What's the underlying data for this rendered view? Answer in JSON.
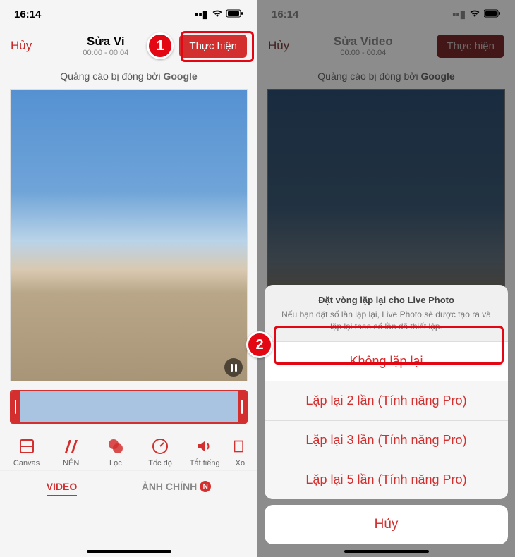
{
  "status": {
    "time": "16:14"
  },
  "header": {
    "cancel": "Hủy",
    "titleFull": "Sửa Video",
    "titleCut": "Sửa Vi",
    "timecode": "00:00 - 00:04",
    "exec": "Thực hiện"
  },
  "ad": {
    "prefix": "Quảng cáo bị đóng bởi ",
    "brand": "Google"
  },
  "tools": {
    "canvas": "Canvas",
    "nen": "NÊN",
    "loc": "Lọc",
    "tocdo": "Tốc độ",
    "tattieng": "Tắt tiếng",
    "xo": "Xo"
  },
  "tabs": {
    "video": "VIDEO",
    "anhchinh": "ẢNH CHÍNH",
    "badge": "N"
  },
  "sheet": {
    "title": "Đặt vòng lặp lại cho Live Photo",
    "desc": "Nếu bạn đặt số lần lặp lại, Live Photo sẽ được tạo ra và lặp lại theo số lần đã thiết lập.",
    "opt1": "Không lặp lại",
    "opt2": "Lặp lại 2 lần (Tính năng Pro)",
    "opt3": "Lặp lại 3 lần (Tính năng Pro)",
    "opt4": "Lặp lại 5 lần (Tính năng Pro)",
    "cancel": "Hủy"
  },
  "callouts": {
    "one": "1",
    "two": "2"
  }
}
